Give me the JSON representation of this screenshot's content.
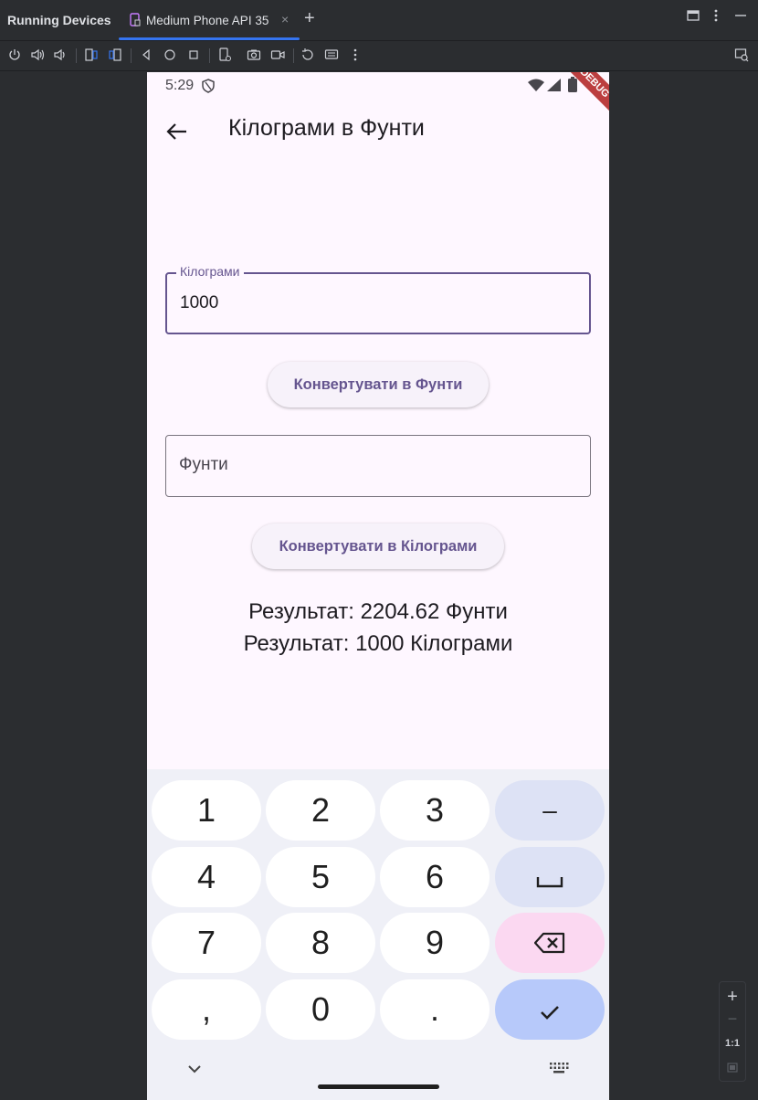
{
  "ide": {
    "tool_window_title": "Running Devices",
    "device_tab_label": "Medium Phone API 35",
    "close_tab_symbol": "×",
    "add_tab_symbol": "+",
    "accent_color": "#3574f0"
  },
  "phone": {
    "status_time": "5:29",
    "debug_banner": "DEBUG",
    "app_bar_title": "Кілограми в Фунти",
    "kg_field": {
      "label": "Кілограми",
      "value": "1000"
    },
    "convert_to_lb_button": "Конвертувати в Фунти",
    "lb_field": {
      "placeholder": "Фунти"
    },
    "convert_to_kg_button": "Конвертувати в Кілограми",
    "result_lb": "Результат: 2204.62 Фунти",
    "result_kg": "Результат: 1000 Кілограми",
    "primary_color": "#65558f",
    "background_color": "#fef7ff"
  },
  "keyboard": {
    "keys": [
      "1",
      "2",
      "3",
      "–",
      "4",
      "5",
      "6",
      "␣",
      "7",
      "8",
      "9",
      "⌫",
      ",",
      "0",
      ".",
      "✓"
    ]
  },
  "zoom": {
    "actual_size_label": "1:1"
  }
}
